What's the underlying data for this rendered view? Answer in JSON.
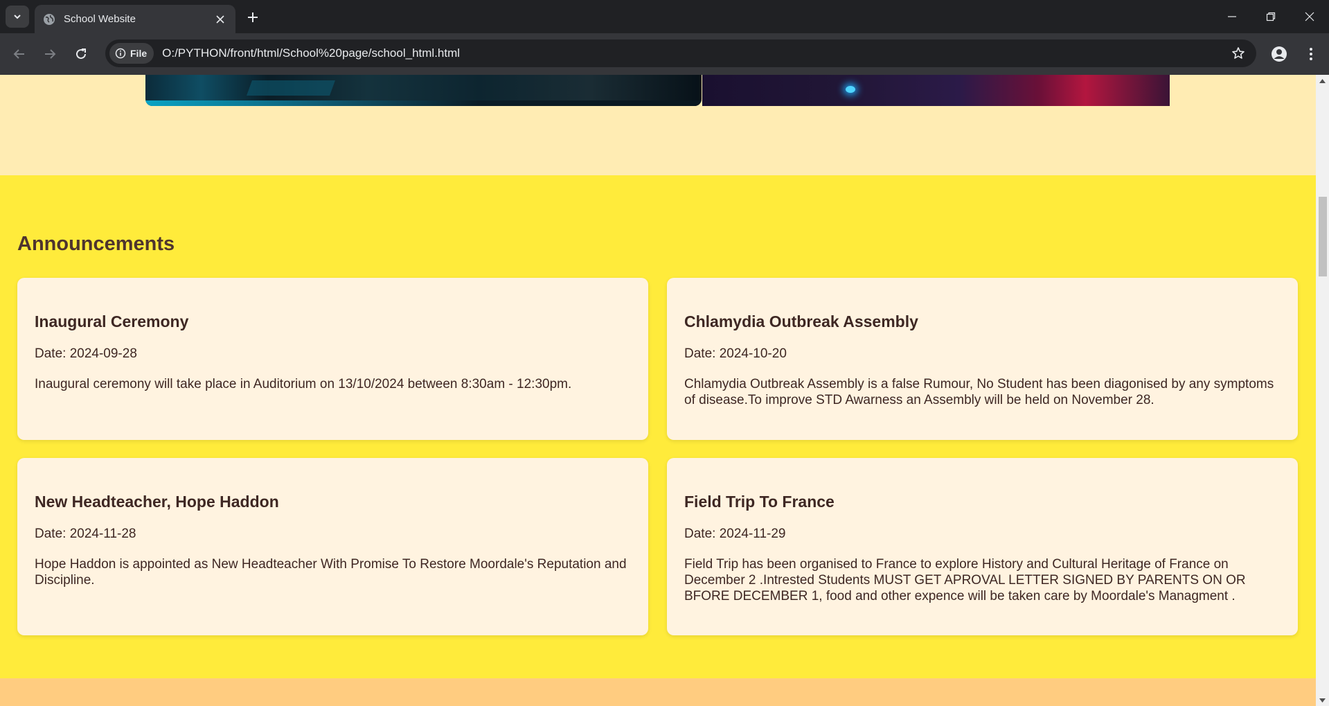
{
  "browser": {
    "tab_title": "School Website",
    "url": "O:/PYTHON/front/html/School%20page/school_html.html",
    "site_info_chip": "File"
  },
  "page": {
    "announcements_heading": "Announcements",
    "announcements": [
      {
        "title": "Inaugural Ceremony",
        "date": "Date: 2024-09-28",
        "description": "Inaugural ceremony will take place in Auditorium on 13/10/2024 between 8:30am - 12:30pm."
      },
      {
        "title": "Chlamydia Outbreak Assembly",
        "date": "Date: 2024-10-20",
        "description": "Chlamydia Outbreak Assembly is a false Rumour, No Student has been diagonised by any symptoms of disease.To improve STD Awarness an Assembly will be held on November 28."
      },
      {
        "title": "New Headteacher, Hope Haddon",
        "date": "Date: 2024-11-28",
        "description": "Hope Haddon is appointed as New Headteacher With Promise To Restore Moordale's Reputation and Discipline."
      },
      {
        "title": "Field Trip To France",
        "date": "Date: 2024-11-29",
        "description": "Field Trip has been organised to France to explore History and Cultural Heritage of France on December 2 .Intrested Students MUST GET APROVAL LETTER SIGNED BY PARENTS ON OR BFORE DECEMBER 1, food and other expence will be taken care by Moordale's Managment ."
      }
    ]
  },
  "colors": {
    "announcement_bg": "#ffeb3b",
    "gallery_bg": "#ffecb3",
    "card_bg": "#fff3e0",
    "heading_text": "#4e342e",
    "footer_bg": "#ffcc80"
  },
  "icons": [
    "tab-search-icon",
    "globe-icon",
    "close-icon",
    "plus-icon",
    "minimize-icon",
    "restore-icon",
    "back-icon",
    "forward-icon",
    "reload-icon",
    "info-icon",
    "star-icon",
    "profile-icon",
    "kebab-menu-icon"
  ]
}
